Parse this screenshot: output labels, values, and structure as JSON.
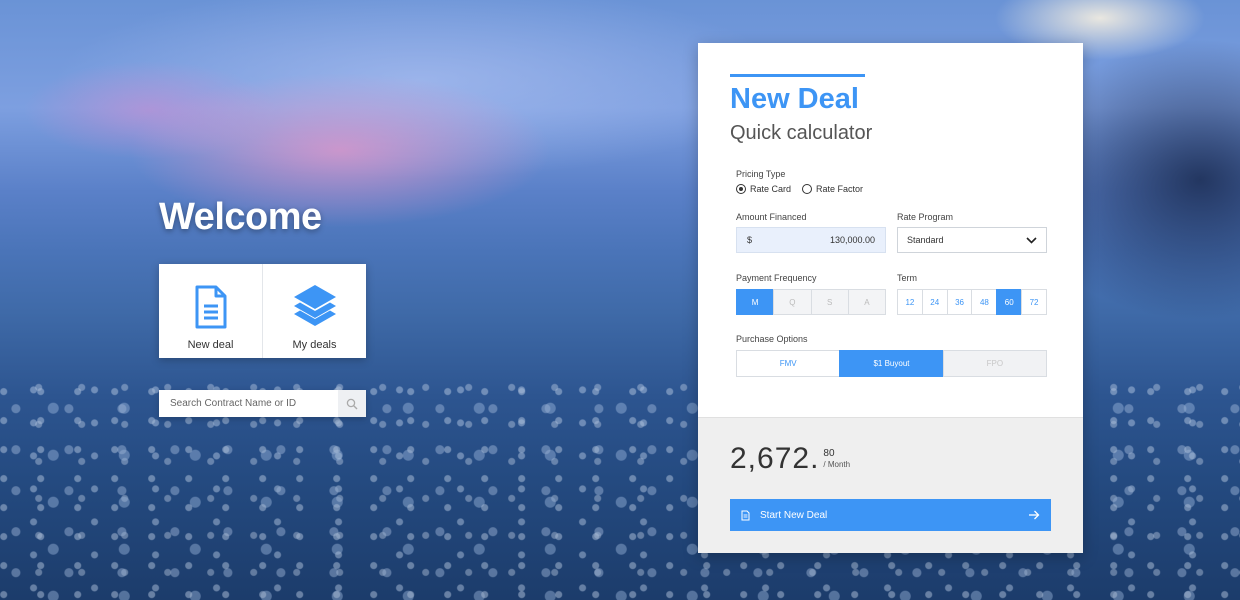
{
  "welcome": {
    "title": "Welcome"
  },
  "tiles": {
    "new_deal_label": "New deal",
    "my_deals_label": "My deals"
  },
  "search": {
    "placeholder": "Search Contract Name or ID"
  },
  "calculator": {
    "title": "New Deal",
    "subtitle": "Quick calculator",
    "pricing_type": {
      "label": "Pricing Type",
      "options": [
        {
          "label": "Rate Card",
          "selected": true
        },
        {
          "label": "Rate Factor",
          "selected": false
        }
      ]
    },
    "amount_financed": {
      "label": "Amount Financed",
      "currency": "$",
      "value": "130,000.00"
    },
    "rate_program": {
      "label": "Rate Program",
      "value": "Standard"
    },
    "payment_frequency": {
      "label": "Payment Frequency",
      "options": [
        "M",
        "Q",
        "S",
        "A"
      ],
      "selected": "M"
    },
    "term": {
      "label": "Term",
      "options": [
        "12",
        "24",
        "36",
        "48",
        "60",
        "72"
      ],
      "selected": "60"
    },
    "purchase_options": {
      "label": "Purchase Options",
      "options": [
        "FMV",
        "$1 Buyout",
        "FPO"
      ],
      "selected": "$1 Buyout"
    },
    "result": {
      "main": "2,672.",
      "cents": "80",
      "per": "/ Month"
    },
    "start_button": {
      "label": "Start New Deal"
    }
  },
  "colors": {
    "accent": "#3d95f5",
    "field_bg": "#e9f0fc",
    "footer_bg": "#efefef"
  }
}
